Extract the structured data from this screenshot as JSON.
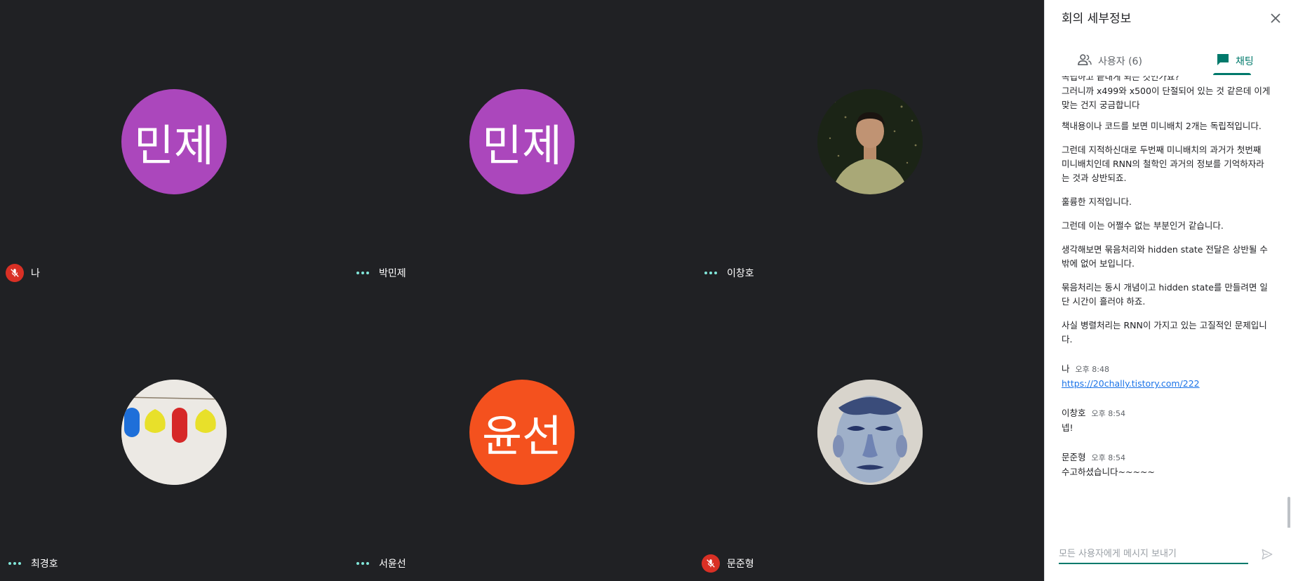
{
  "tiles": [
    {
      "name": "나",
      "avatar_text": "민제",
      "avatar_color": "#ab47bc",
      "status": "muted"
    },
    {
      "name": "박민제",
      "avatar_text": "민제",
      "avatar_color": "#ab47bc",
      "status": "dots"
    },
    {
      "name": "이창호",
      "avatar_text": "",
      "avatar_color": "#1e2a1a",
      "status": "dots"
    },
    {
      "name": "최경호",
      "avatar_text": "",
      "avatar_color": "#e6e6e0",
      "status": "dots"
    },
    {
      "name": "서윤선",
      "avatar_text": "윤선",
      "avatar_color": "#f4511e",
      "status": "dots"
    },
    {
      "name": "문준형",
      "avatar_text": "",
      "avatar_color": "#d9d5cf",
      "status": "muted"
    }
  ],
  "panel": {
    "title": "회의 세부정보",
    "tab_users": "사용자 (6)",
    "tab_chat": "채팅",
    "input_placeholder": "모든 사용자에게 메시지 보내기"
  },
  "chat": {
    "cut_line": "독립하고 끝내게 되는 것인가요?",
    "para1": "그러니까 x499와 x500이 단절되어 있는 것 같은데 이게 맞는 건지 궁금합니다",
    "reply1": "책내용이나 코드를 보면 미니배치 2개는 독립적입니다.",
    "reply2": "그런데 지적하신대로 두번째 미니배치의 과거가 첫번째 미니배치인데 RNN의 철학인 과거의 정보를 기억하자라는 것과 상반되죠.",
    "reply3": "훌륭한 지적입니다.",
    "reply4": "그런데 이는 어쩔수 없는 부분인거 같습니다.",
    "reply5": "생각해보면 묶음처리와 hidden state 전달은 상반될 수 밖에 없어 보입니다.",
    "reply6": "묶음처리는 동시 개념이고 hidden state를 만들려면 일단 시간이 흘러야 하죠.",
    "reply7": "사실 병렬처리는 RNN이 가지고 있는 고질적인 문제입니다.",
    "m1_sender": "나",
    "m1_time": "오후 8:48",
    "m1_link": "https://20chally.tistory.com/222",
    "m2_sender": "이창호",
    "m2_time": "오후 8:54",
    "m2_text": "넵!",
    "m3_sender": "문준형",
    "m3_time": "오후 8:54",
    "m3_text": "수고하셨습니다~~~~~"
  }
}
